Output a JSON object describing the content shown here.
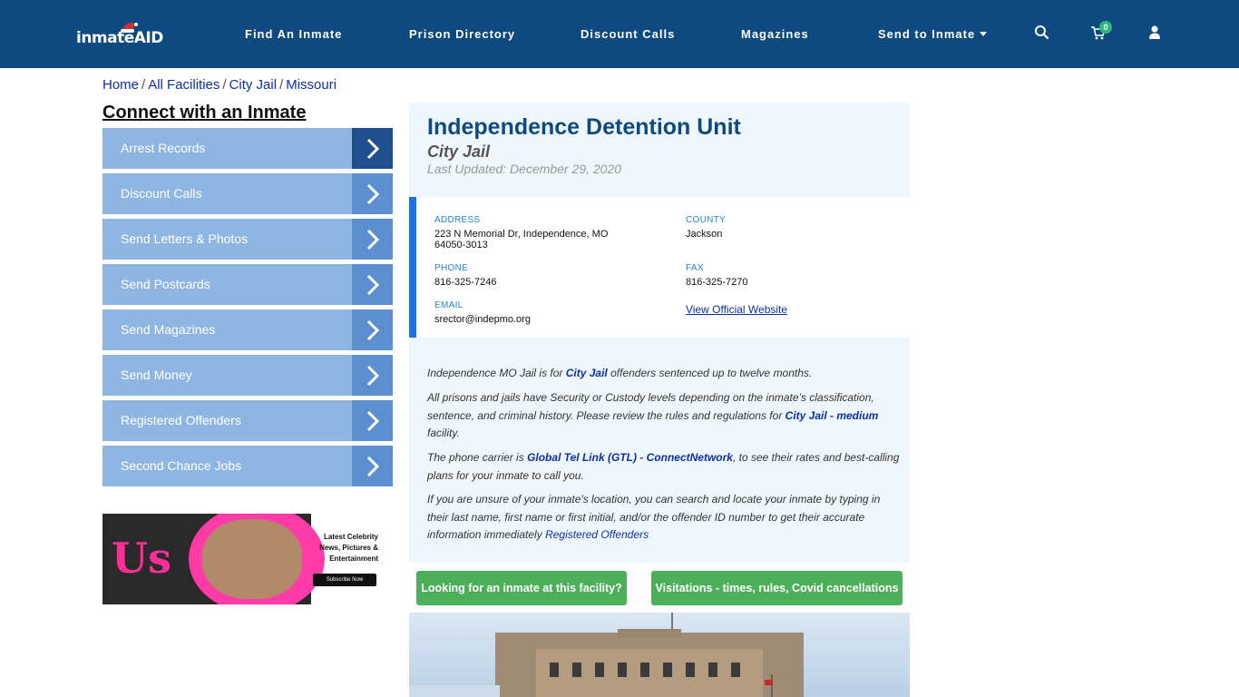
{
  "header": {
    "logo_text": "inmateAID",
    "nav": [
      {
        "label": "Find An Inmate"
      },
      {
        "label": "Prison Directory"
      },
      {
        "label": "Discount Calls"
      },
      {
        "label": "Magazines"
      },
      {
        "label": "Send to Inmate"
      }
    ],
    "cart_count": "0",
    "icons": [
      "search-icon",
      "cart-icon",
      "user-icon"
    ]
  },
  "breadcrumb": [
    "Home",
    "All Facilities",
    "City Jail",
    "Missouri"
  ],
  "sidebar": {
    "title": "Connect with an Inmate",
    "items": [
      {
        "label": "Arrest Records"
      },
      {
        "label": "Discount Calls"
      },
      {
        "label": "Send Letters & Photos"
      },
      {
        "label": "Send Postcards"
      },
      {
        "label": "Send Magazines"
      },
      {
        "label": "Send Money"
      },
      {
        "label": "Registered Offenders"
      },
      {
        "label": "Second Chance Jobs"
      }
    ],
    "ad": {
      "brand": "Us",
      "tagline": "Latest Celebrity News, Pictures & Entertainment",
      "button": "Subscribe Now"
    }
  },
  "facility": {
    "name": "Independence Detention Unit",
    "type": "City Jail",
    "updated": "Last Updated: December 29, 2020",
    "address_label": "ADDRESS",
    "address": "223 N Memorial Dr, Independence, MO 64050-3013",
    "county_label": "COUNTY",
    "county": "Jackson",
    "phone_label": "PHONE",
    "phone": "816-325-7246",
    "fax_label": "FAX",
    "fax": "816-325-7270",
    "email_label": "EMAIL",
    "email": "srector@indepmo.org",
    "website_link": "View Official Website"
  },
  "description": {
    "p1_pre": "Independence MO Jail is for ",
    "p1_link": "City Jail",
    "p1_post": " offenders sentenced up to twelve months.",
    "p2_pre": "All prisons and jails have Security or Custody levels depending on the inmate’s classification, sentence, and criminal history. Please review the rules and regulations for ",
    "p2_link": "City Jail - medium",
    "p2_post": " facility.",
    "p3_pre": "The phone carrier is ",
    "p3_link": "Global Tel Link (GTL) - ConnectNetwork",
    "p3_post": ", to see their rates and best-calling plans for your inmate to call you.",
    "p4_pre": "If you are unsure of your inmate's location, you can search and locate your inmate by typing in their last name, first name or first initial, and/or the offender ID number to get their accurate information immediately ",
    "p4_link": "Registered Offenders"
  },
  "actions": {
    "find_inmate": "Looking for an inmate at this facility?",
    "visitations": "Visitations - times, rules, Covid cancellations"
  },
  "colors": {
    "header_bg": "#0e4a7f",
    "sidebar_btn": "#8fb6e3",
    "sidebar_arrow": "#5b8fd0",
    "green_btn": "#4cb05a",
    "link": "#0d2ea8"
  }
}
